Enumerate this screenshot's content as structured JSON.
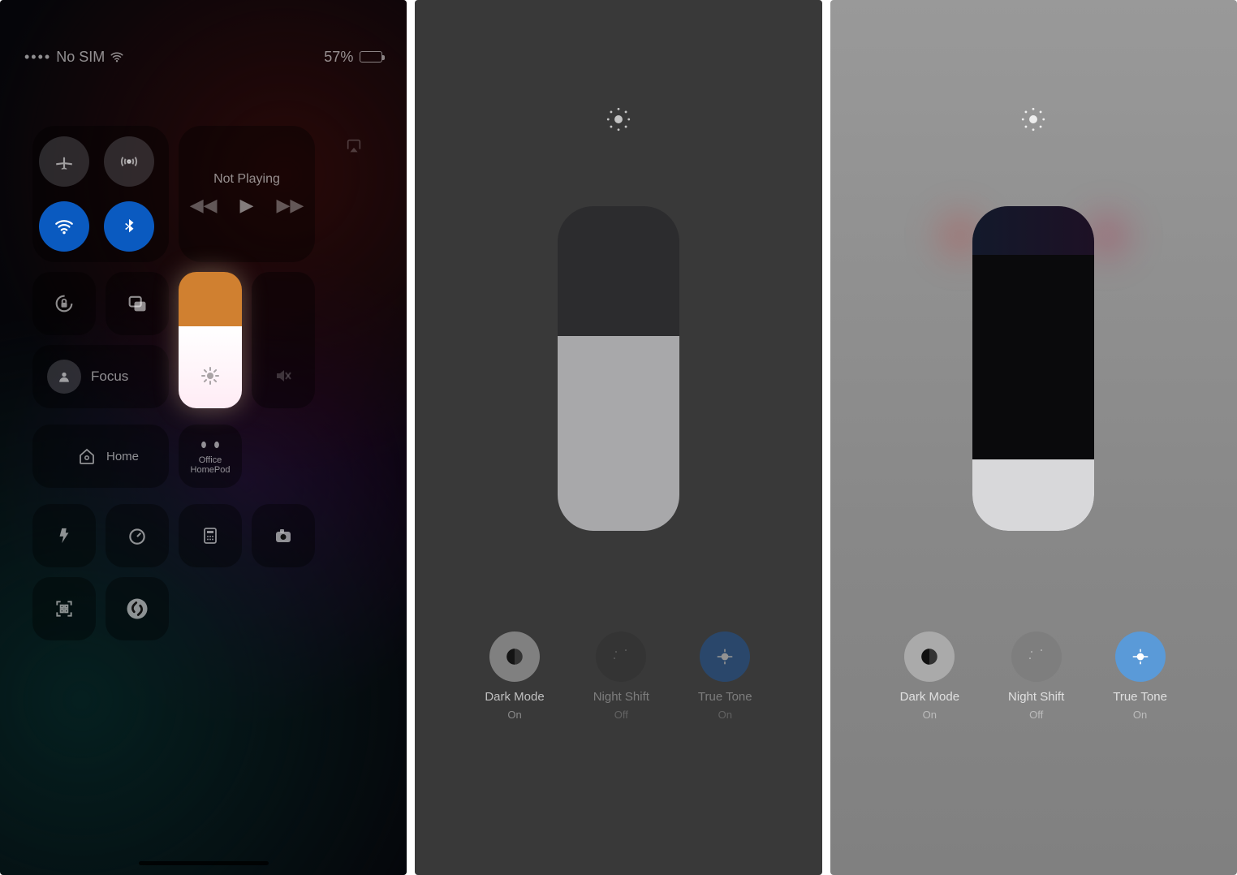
{
  "s1": {
    "status": {
      "carrier": "No SIM",
      "battery_pct": "57%",
      "battery_fill_pct": 57
    },
    "media": {
      "title": "Not Playing"
    },
    "focus_label": "Focus",
    "home_label": "Home",
    "homepod_line1": "Office",
    "homepod_line2": "HomePod",
    "brightness_pct": 60
  },
  "s2": {
    "brightness_pct": 60,
    "buttons": {
      "dark": {
        "label": "Dark Mode",
        "state": "On"
      },
      "night": {
        "label": "Night Shift",
        "state": "Off"
      },
      "tone": {
        "label": "True Tone",
        "state": "On"
      }
    }
  },
  "s3": {
    "brightness_pct": 22,
    "buttons": {
      "dark": {
        "label": "Dark Mode",
        "state": "On"
      },
      "night": {
        "label": "Night Shift",
        "state": "Off"
      },
      "tone": {
        "label": "True Tone",
        "state": "On"
      }
    }
  }
}
